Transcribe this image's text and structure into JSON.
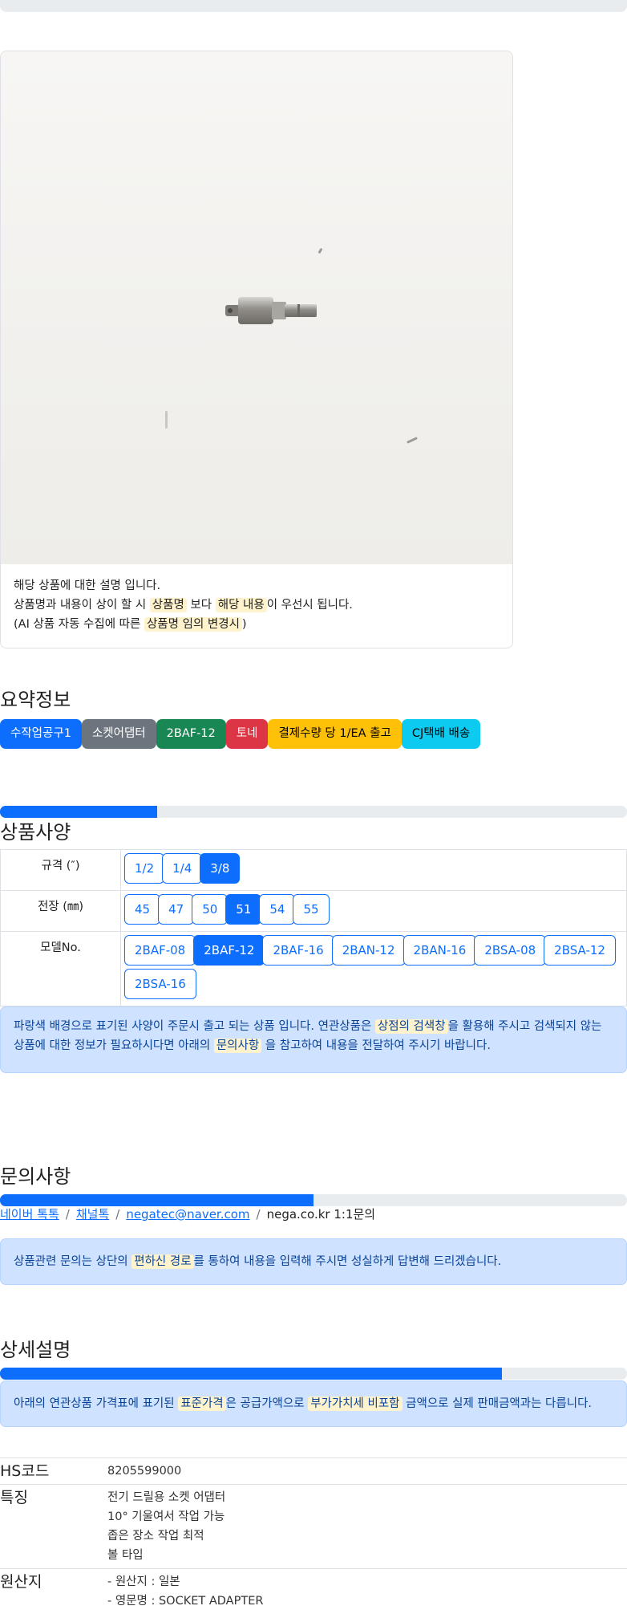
{
  "description": {
    "line1": "해당 상품에 대한 설명 입니다.",
    "line2_pre": "상품명과 내용이 상이 할 시 ",
    "line2_hl1": "상품명",
    "line2_mid": " 보다 ",
    "line2_hl2": "해당 내용",
    "line2_post": "이 우선시 됩니다.",
    "line3_pre": "(AI 상품 자동 수집에 따른 ",
    "line3_hl": "상품명 임의 변경시",
    "line3_post": ")"
  },
  "summary": {
    "title": "요약정보",
    "badges": [
      {
        "label": "수작업공구1",
        "color": "#0d6efd"
      },
      {
        "label": "소켓어댑터",
        "color": "#6c757d"
      },
      {
        "label": "2BAF-12",
        "color": "#198754"
      },
      {
        "label": "토네",
        "color": "#dc3545"
      },
      {
        "label": "결제수량 당 1/EA 출고",
        "color": "#ffc107"
      },
      {
        "label": "CJ택배 배송",
        "color": "#0dcaf0"
      }
    ]
  },
  "specs": {
    "title": "상품사양",
    "progress": 0.25,
    "rows": [
      {
        "label": "규격 (″)",
        "options": [
          "1/2",
          "1/4",
          "3/8"
        ],
        "active": "3/8"
      },
      {
        "label": "전장 (㎜)",
        "options": [
          "45",
          "47",
          "50",
          "51",
          "54",
          "55"
        ],
        "active": "51"
      },
      {
        "label": "모델No.",
        "options": [
          "2BAF-08",
          "2BAF-12",
          "2BAF-16",
          "2BAN-12",
          "2BAN-16",
          "2BSA-08",
          "2BSA-12",
          "2BSA-16"
        ],
        "active": "2BAF-12"
      }
    ],
    "note_pre": "파랑색 배경으로 표기된 사양이 주문시 출고 되는 상품 입니다. 연관상품은 ",
    "note_hl1": "상점의 검색창",
    "note_mid": "을 활용해 주시고 검색되지 않는 상품에 대한 정보가 필요하시다면 아래의 ",
    "note_hl2": "문의사항",
    "note_post": " 을 참고하여 내용을 전달하여 주시기 바랍니다."
  },
  "inquiry": {
    "title": "문의사항",
    "progress": 0.5,
    "links": [
      "네이버 톡톡",
      "채널톡",
      "negatec@naver.com"
    ],
    "plain": "nega.co.kr 1:1문의",
    "sep": "/",
    "note_pre": "상품관련 문의는 상단의 ",
    "note_hl": "편하신 경로",
    "note_post": "를 통하여 내용을 입력해 주시면 성실하게 답변해 드리겠습니다."
  },
  "details": {
    "title": "상세설명",
    "progress": 0.8,
    "note_pre": "아래의 연관상품 가격표에 표기된 ",
    "note_hl1": "표준가격",
    "note_mid": "은 공급가액으로 ",
    "note_hl2": "부가가치세 비포함",
    "note_post": " 금액으로 실제 판매금액과는 다릅니다.",
    "rows": [
      {
        "key": "HS코드",
        "values": [
          "8205599000"
        ]
      },
      {
        "key": "특징",
        "values": [
          "전기 드릴용 소켓 어댑터",
          "10° 기울여서 작업 가능",
          "좁은 장소 작업 최적",
          "볼 타입"
        ]
      },
      {
        "key": "원산지",
        "values": [
          "- 원산지 : 일본",
          "- 영문명 : SOCKET ADAPTER"
        ]
      }
    ]
  }
}
